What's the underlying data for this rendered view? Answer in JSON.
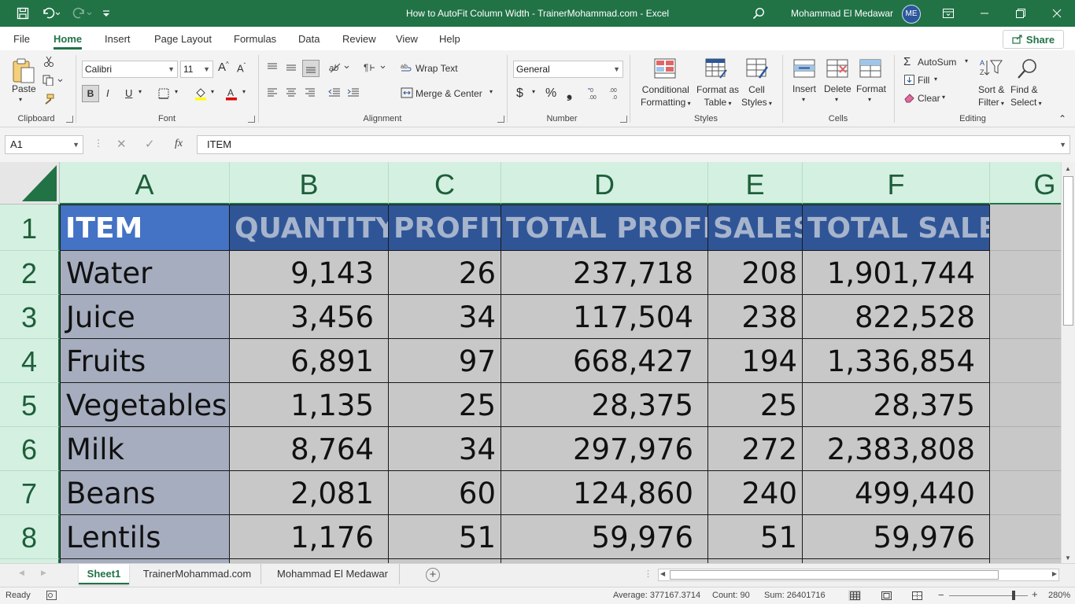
{
  "window": {
    "title": "How to AutoFit Column Width - TrainerMohammad.com  -  Excel",
    "user_name": "Mohammad El Medawar",
    "user_initials": "ME"
  },
  "menu": {
    "tabs": [
      "File",
      "Home",
      "Insert",
      "Page Layout",
      "Formulas",
      "Data",
      "Review",
      "View",
      "Help"
    ],
    "active_tab": "Home",
    "share_label": "Share"
  },
  "ribbon": {
    "clipboard": {
      "label": "Clipboard",
      "paste": "Paste"
    },
    "font": {
      "label": "Font",
      "font_name": "Calibri",
      "font_size": "11",
      "bold": "B",
      "italic": "I",
      "underline": "U"
    },
    "alignment": {
      "label": "Alignment",
      "wrap_text": "Wrap Text",
      "merge_center": "Merge & Center"
    },
    "number": {
      "label": "Number",
      "format": "General"
    },
    "styles": {
      "label": "Styles",
      "conditional": [
        "Conditional",
        "Formatting"
      ],
      "format_table": [
        "Format as",
        "Table"
      ],
      "cell_styles": [
        "Cell",
        "Styles"
      ]
    },
    "cells": {
      "label": "Cells",
      "insert": "Insert",
      "delete": "Delete",
      "format": "Format"
    },
    "editing": {
      "label": "Editing",
      "autosum": "AutoSum",
      "fill": "Fill",
      "clear": "Clear",
      "sort_filter": [
        "Sort &",
        "Filter"
      ],
      "find_select": [
        "Find &",
        "Select"
      ]
    }
  },
  "formula_bar": {
    "name_box": "A1",
    "fx": "fx",
    "content": "ITEM"
  },
  "sheet": {
    "columns": [
      "A",
      "B",
      "C",
      "D",
      "E",
      "F",
      "G"
    ],
    "rows": [
      "1",
      "2",
      "3",
      "4",
      "5",
      "6",
      "7",
      "8"
    ],
    "headers": [
      "ITEM",
      "QUANTITY",
      "PROFIT",
      "TOTAL PROFIT",
      "SALES",
      "TOTAL SALES"
    ],
    "data": [
      [
        "Water",
        "9,143",
        "26",
        "237,718",
        "208",
        "1,901,744"
      ],
      [
        "Juice",
        "3,456",
        "34",
        "117,504",
        "238",
        "822,528"
      ],
      [
        "Fruits",
        "6,891",
        "97",
        "668,427",
        "194",
        "1,336,854"
      ],
      [
        "Vegetables",
        "1,135",
        "25",
        "28,375",
        "25",
        "28,375"
      ],
      [
        "Milk",
        "8,764",
        "34",
        "297,976",
        "272",
        "2,383,808"
      ],
      [
        "Beans",
        "2,081",
        "60",
        "124,860",
        "240",
        "499,440"
      ],
      [
        "Lentils",
        "1,176",
        "51",
        "59,976",
        "51",
        "59,976"
      ]
    ]
  },
  "sheet_tabs": [
    "Sheet1",
    "TrainerMohammad.com",
    "Mohammad El Medawar"
  ],
  "active_sheet": "Sheet1",
  "status": {
    "mode": "Ready",
    "average": "Average: 377167.3714",
    "count": "Count: 90",
    "sum": "Sum: 26401716",
    "zoom": "280%",
    "zoom_level": 0.82
  },
  "colors": {
    "excel_green": "#217346",
    "header_fill": "#2f5597",
    "header_first_fill": "#4472c4",
    "item_fill": "#a6adbe",
    "data_fill": "#c8c8c8"
  }
}
